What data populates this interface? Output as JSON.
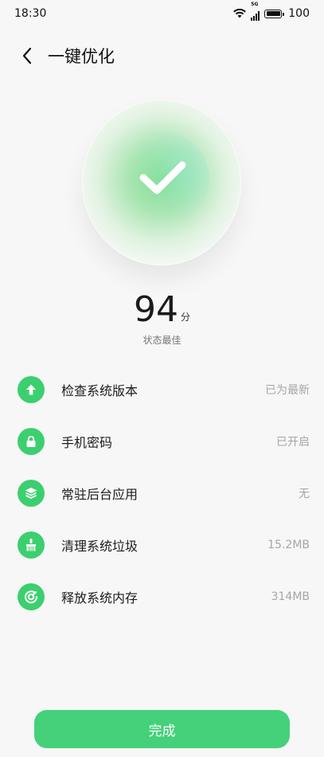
{
  "status_bar": {
    "time": "18:30",
    "battery": "100",
    "network_badge": "5G"
  },
  "header": {
    "title": "一键优化"
  },
  "result": {
    "score": "94",
    "unit": "分",
    "status": "状态最佳"
  },
  "items": [
    {
      "label": "检查系统版本",
      "value": "已为最新",
      "icon": "arrow-up-icon"
    },
    {
      "label": "手机密码",
      "value": "已开启",
      "icon": "lock-icon"
    },
    {
      "label": "常驻后台应用",
      "value": "无",
      "icon": "layers-icon"
    },
    {
      "label": "清理系统垃圾",
      "value": "15.2MB",
      "icon": "broom-icon"
    },
    {
      "label": "释放系统内存",
      "value": "314MB",
      "icon": "memory-gauge-icon"
    }
  ],
  "done_button": "完成",
  "colors": {
    "accent": "#3ccf6f",
    "button": "#44d17a",
    "background": "#f7f7f7"
  }
}
